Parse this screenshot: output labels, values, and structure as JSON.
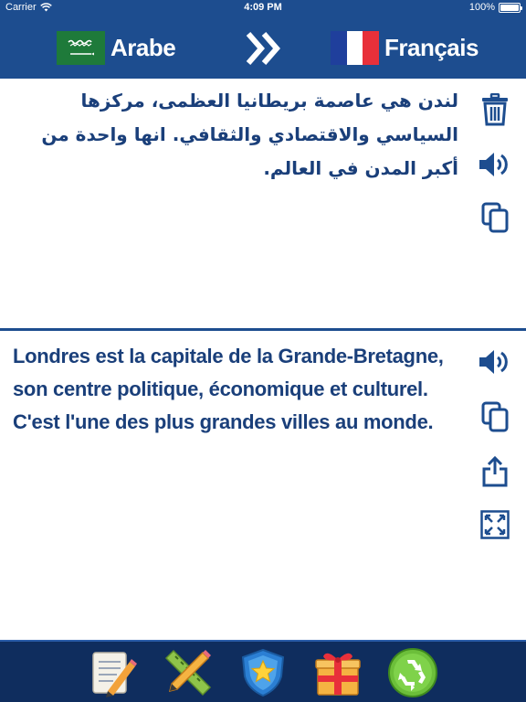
{
  "status_bar": {
    "carrier": "Carrier",
    "time": "4:09 PM",
    "battery": "100%",
    "battery_level": 1.0
  },
  "header": {
    "source_language": "Arabe",
    "target_language": "Français",
    "swap_icon": "double-chevron-right-icon",
    "colors": {
      "bar": "#1d4d8f",
      "saudi_green": "#1e7a3a",
      "france_blue": "#1f3f9c",
      "france_white": "#ffffff",
      "france_red": "#e8303a"
    }
  },
  "source_pane": {
    "text": "لندن هي عاصمة بريطانيا العظمى، مركزها السياسي والاقتصادي والثقافي. انها واحدة من أكبر المدن في العالم.",
    "actions": [
      {
        "name": "delete",
        "icon": "trash-icon"
      },
      {
        "name": "speak",
        "icon": "speaker-icon"
      },
      {
        "name": "copy",
        "icon": "copy-icon"
      }
    ]
  },
  "target_pane": {
    "text": "Londres est la capitale de la Grande-Bretagne, son centre politique, économique et culturel. C'est l'une des plus grandes villes au monde.",
    "actions": [
      {
        "name": "speak",
        "icon": "speaker-icon"
      },
      {
        "name": "copy",
        "icon": "copy-icon"
      },
      {
        "name": "share",
        "icon": "share-icon"
      },
      {
        "name": "fullscreen",
        "icon": "expand-icon"
      }
    ]
  },
  "toolbar": {
    "items": [
      {
        "name": "notes",
        "icon": "notepad-pencil-icon"
      },
      {
        "name": "tools",
        "icon": "pencil-ruler-icon"
      },
      {
        "name": "favorites",
        "icon": "star-shield-icon"
      },
      {
        "name": "gift",
        "icon": "gift-box-icon"
      },
      {
        "name": "recycle",
        "icon": "recycle-icon"
      }
    ],
    "colors": {
      "bar": "#0f2d5e",
      "accent": "#2a5ca8"
    }
  },
  "text_color": "#1a3f7a"
}
